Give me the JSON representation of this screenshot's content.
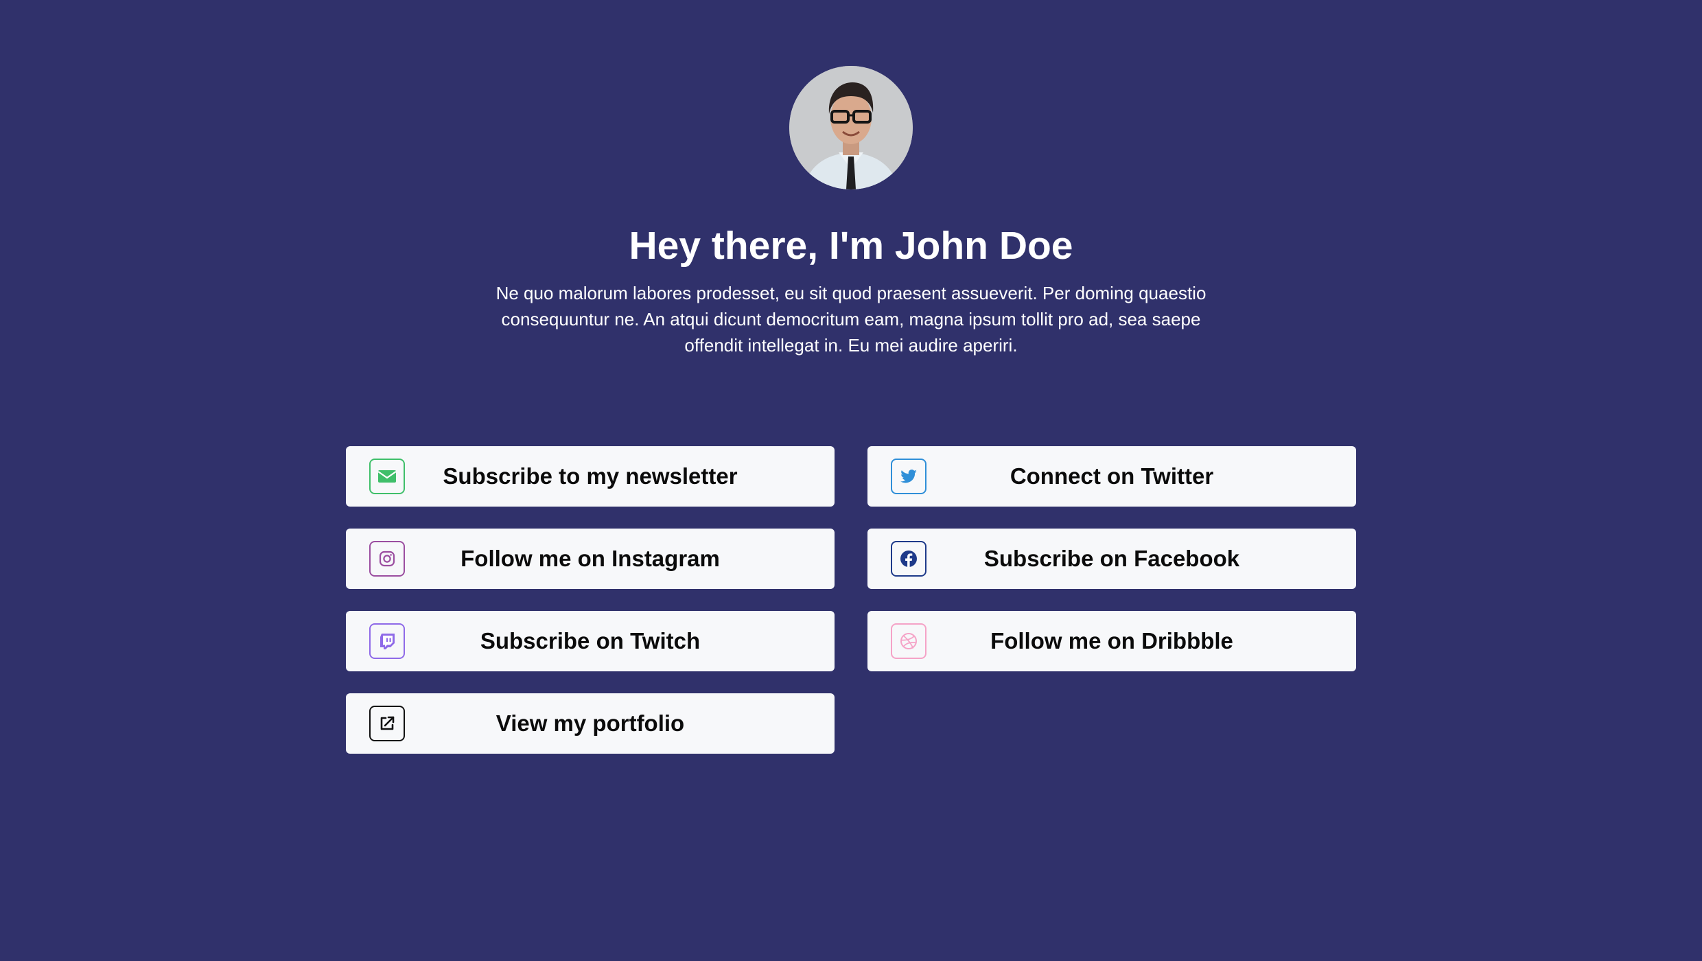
{
  "profile": {
    "title": "Hey there, I'm John Doe",
    "bio": "Ne quo malorum labores prodesset, eu sit quod praesent assueverit. Per doming quaestio consequuntur ne. An atqui dicunt democritum eam, magna ipsum tollit pro ad, sea saepe offendit intellegat in. Eu mei audire aperiri."
  },
  "links": {
    "newsletter": {
      "label": "Subscribe to my newsletter",
      "icon": "envelope-icon",
      "color": "#3fbf6a"
    },
    "twitter": {
      "label": "Connect on Twitter",
      "icon": "twitter-icon",
      "color": "#2f8fd8"
    },
    "instagram": {
      "label": "Follow me on Instagram",
      "icon": "instagram-icon",
      "color": "#9b4ea0"
    },
    "facebook": {
      "label": "Subscribe on Facebook",
      "icon": "facebook-icon",
      "color": "#1e3a8a"
    },
    "twitch": {
      "label": "Subscribe on Twitch",
      "icon": "twitch-icon",
      "color": "#8f6ae8"
    },
    "dribbble": {
      "label": "Follow me on Dribbble",
      "icon": "dribbble-icon",
      "color": "#f5a3c7"
    },
    "portfolio": {
      "label": "View my portfolio",
      "icon": "external-link-icon",
      "color": "#111111"
    }
  },
  "colors": {
    "background": "#30316b",
    "button_background": "#f7f8fa",
    "text": "#ffffff"
  }
}
